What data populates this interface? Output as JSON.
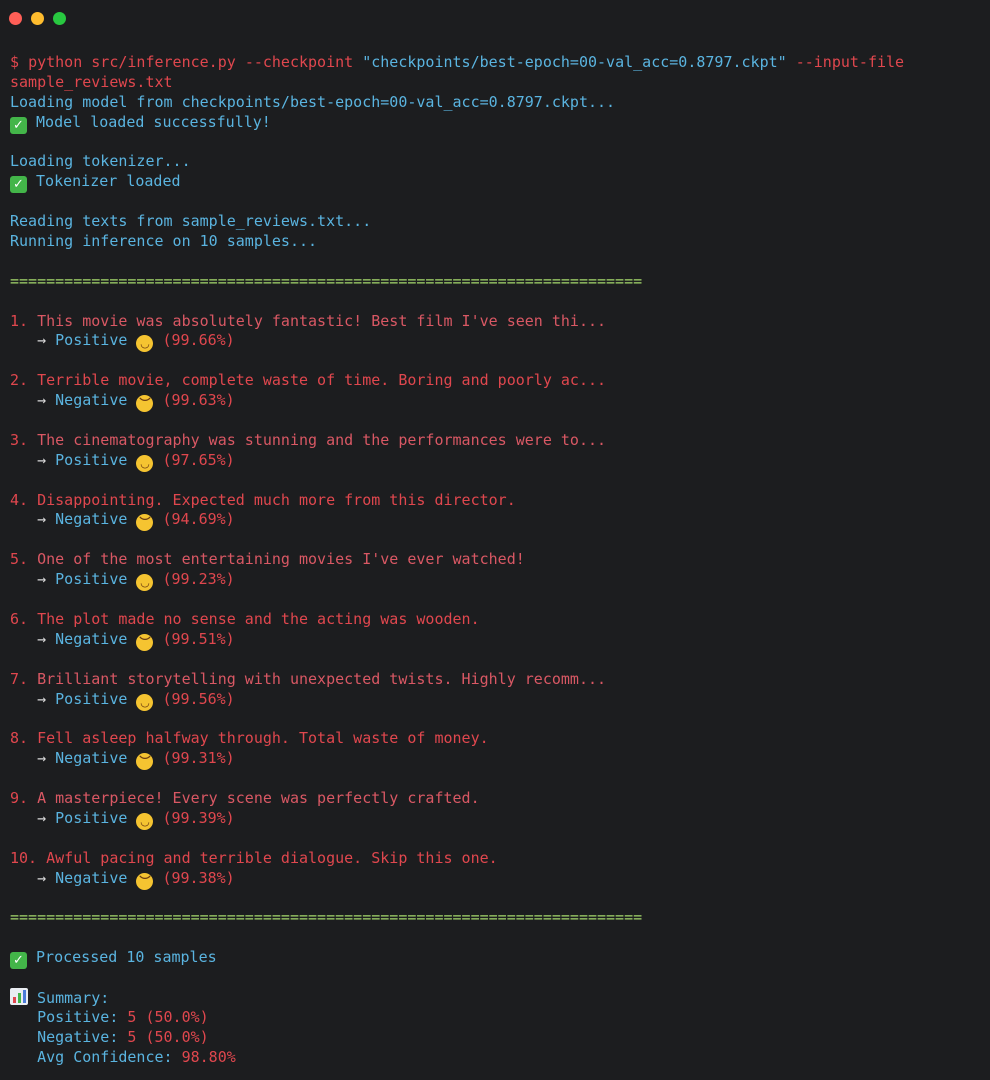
{
  "window": {
    "controls": {
      "close_color": "#ff5f57",
      "minimize_color": "#febc2e",
      "zoom_color": "#28c840"
    }
  },
  "icons": {
    "success": "check-mark-button-emoji",
    "smile": "smiling-face-emoji",
    "sad": "disappointed-face-emoji",
    "chart": "bar-chart-emoji"
  },
  "terminal": {
    "command": {
      "prompt": "$",
      "program": "python",
      "script": "src/inference.py",
      "flag_checkpoint": "--checkpoint",
      "checkpoint_value": "\"checkpoints/best-epoch=00-val_acc=0.8797.ckpt\"",
      "flag_input": "--input-file",
      "input_value": "sample_reviews.txt"
    },
    "loading_model": "Loading model from checkpoints/best-epoch=00-val_acc=0.8797.ckpt...",
    "model_loaded": "Model loaded successfully!",
    "loading_tokenizer": "Loading tokenizer...",
    "tokenizer_loaded": "Tokenizer loaded",
    "reading": "Reading texts from sample_reviews.txt...",
    "running": "Running inference on 10 samples...",
    "separator": "======================================================================",
    "results": [
      {
        "index": "1.",
        "text": "This movie was absolutely fantastic! Best film I've seen thi...",
        "label": "Positive",
        "confidence": "(99.66%)"
      },
      {
        "index": "2.",
        "text": "Terrible movie, complete waste of time. Boring and poorly ac...",
        "label": "Negative",
        "confidence": "(99.63%)"
      },
      {
        "index": "3.",
        "text": "The cinematography was stunning and the performances were to...",
        "label": "Positive",
        "confidence": "(97.65%)"
      },
      {
        "index": "4.",
        "text": "Disappointing. Expected much more from this director.",
        "label": "Negative",
        "confidence": "(94.69%)"
      },
      {
        "index": "5.",
        "text": "One of the most entertaining movies I've ever watched!",
        "label": "Positive",
        "confidence": "(99.23%)"
      },
      {
        "index": "6.",
        "text": "The plot made no sense and the acting was wooden.",
        "label": "Negative",
        "confidence": "(99.51%)"
      },
      {
        "index": "7.",
        "text": "Brilliant storytelling with unexpected twists. Highly recomm...",
        "label": "Positive",
        "confidence": "(99.56%)"
      },
      {
        "index": "8.",
        "text": "Fell asleep halfway through. Total waste of money.",
        "label": "Negative",
        "confidence": "(99.31%)"
      },
      {
        "index": "9.",
        "text": "A masterpiece! Every scene was perfectly crafted.",
        "label": "Positive",
        "confidence": "(99.39%)"
      },
      {
        "index": "10.",
        "text": "Awful pacing and terrible dialogue. Skip this one.",
        "label": "Negative",
        "confidence": "(99.38%)"
      }
    ],
    "arrow": "→",
    "processed": "Processed 10 samples",
    "summary": {
      "title": "Summary:",
      "positive_label": "Positive:",
      "positive_value": "5 (50.0%)",
      "negative_label": "Negative:",
      "negative_value": "5 (50.0%)",
      "avg_label": "Avg Confidence:",
      "avg_value": "98.80%"
    }
  }
}
